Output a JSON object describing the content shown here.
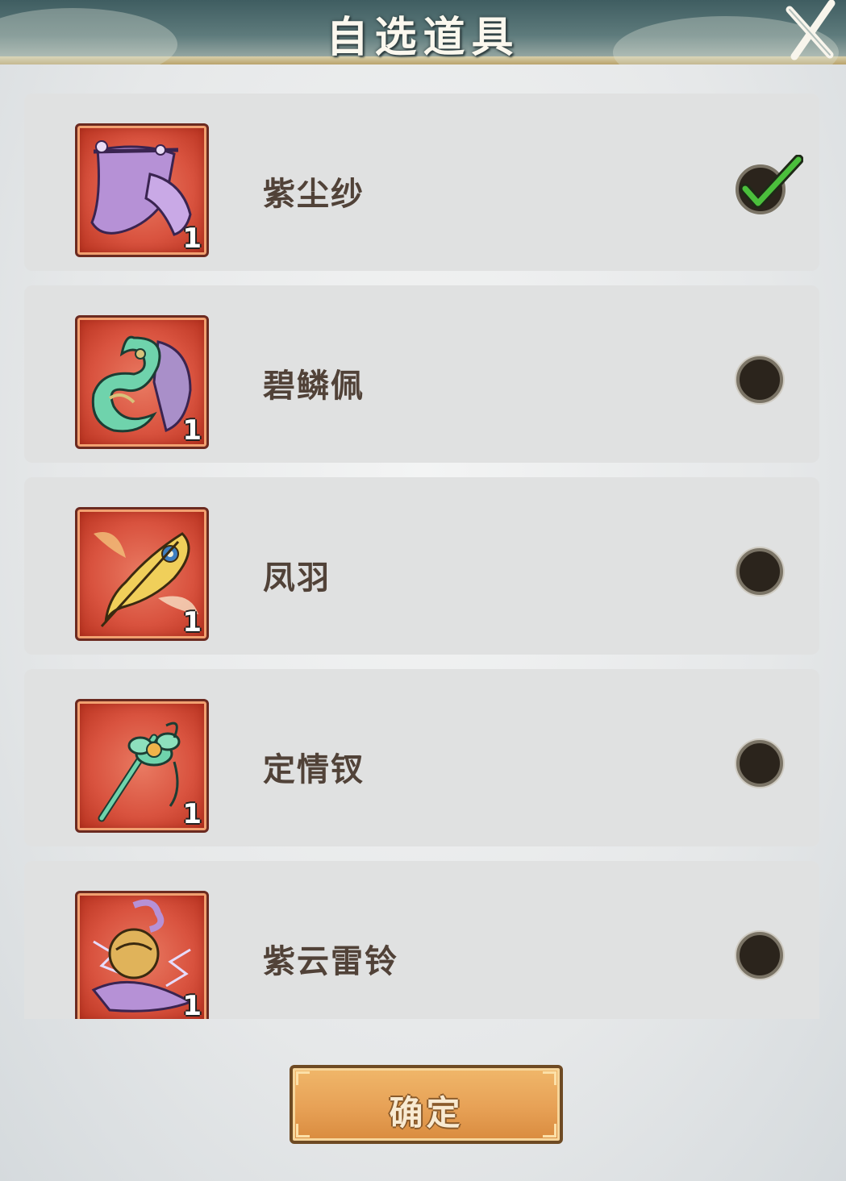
{
  "dialog": {
    "title": "自选道具",
    "confirm_label": "确定"
  },
  "items": [
    {
      "name": "紫尘纱",
      "quantity": "1",
      "icon": "purple-veil-icon",
      "selected": true
    },
    {
      "name": "碧鳞佩",
      "quantity": "1",
      "icon": "jade-pendant-icon",
      "selected": false
    },
    {
      "name": "凤羽",
      "quantity": "1",
      "icon": "phoenix-feather-icon",
      "selected": false
    },
    {
      "name": "定情钗",
      "quantity": "1",
      "icon": "jade-hairpin-icon",
      "selected": false
    },
    {
      "name": "紫云雷铃",
      "quantity": "1",
      "icon": "purple-thunder-bell-icon",
      "selected": false
    }
  ],
  "colors": {
    "icon_bg": "#d9533f",
    "check_green": "#4bbf3c",
    "button": "#e7a156"
  }
}
